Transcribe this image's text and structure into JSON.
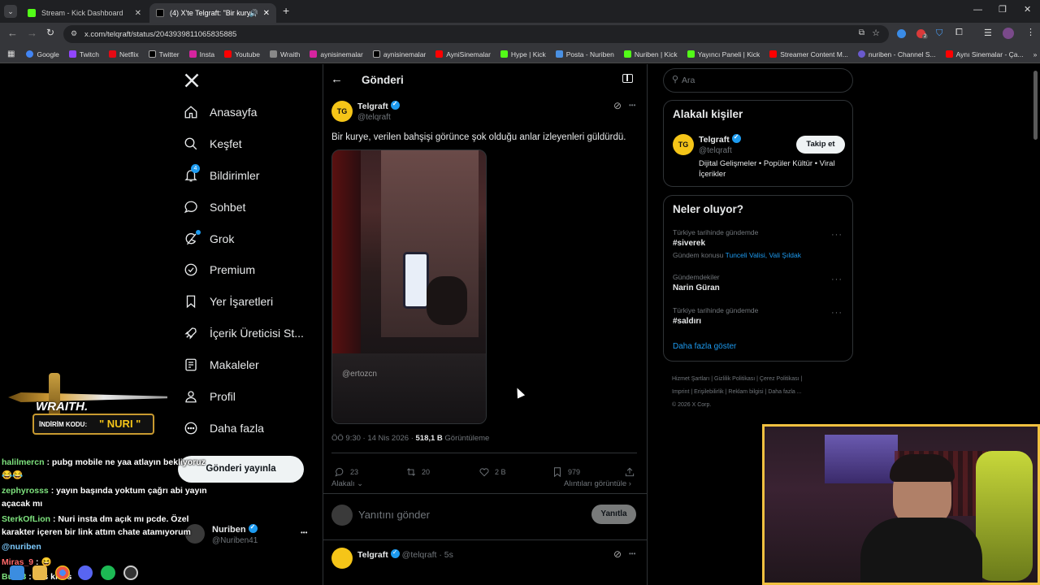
{
  "browser": {
    "tabs": [
      {
        "title": "Stream - Kick Dashboard",
        "active": false
      },
      {
        "title": "(4) X'te Telgraft: \"Bir kurye, ",
        "active": true
      }
    ],
    "new_tab_symbol": "+",
    "url": "x.com/telqraft/status/2043939811065835885",
    "bookmarks": [
      "Google",
      "Twitch",
      "Netflix",
      "Twitter",
      "Insta",
      "Youtube",
      "Wraith",
      "aynisinemalar",
      "aynisinemalar",
      "AyniSinemalar",
      "Hype | Kick",
      "Posta - Nuriben",
      "Nuriben | Kick",
      "Yayıncı Paneli | Kick",
      "Streamer Content M...",
      "nuriben - Channel S...",
      "Aynı Sinemalar - Ça..."
    ],
    "extension_badge": "2"
  },
  "sidebar": {
    "items": [
      {
        "label": "Anasayfa",
        "icon": "home-icon"
      },
      {
        "label": "Keşfet",
        "icon": "search-icon"
      },
      {
        "label": "Bildirimler",
        "icon": "bell-icon"
      },
      {
        "label": "Sohbet",
        "icon": "chat-icon"
      },
      {
        "label": "Grok",
        "icon": "grok-icon"
      },
      {
        "label": "Premium",
        "icon": "premium-icon"
      },
      {
        "label": "Yer İşaretleri",
        "icon": "bookmark-icon"
      },
      {
        "label": "İçerik Üreticisi St...",
        "icon": "rocket-icon"
      },
      {
        "label": "Makaleler",
        "icon": "article-icon"
      },
      {
        "label": "Profil",
        "icon": "person-icon"
      },
      {
        "label": "Daha fazla",
        "icon": "more-circle-icon"
      }
    ],
    "notification_badge": "4",
    "post_button": "Gönderi yayınla",
    "account": {
      "name": "Nuriben",
      "handle": "@Nuriben41",
      "menu": "•••"
    }
  },
  "main": {
    "header_title": "Gönderi",
    "tweet": {
      "author": "Telgraft",
      "handle": "@telqraft",
      "text": "Bir kurye, verilen bahşişi görünce şok olduğu anlar izleyenleri güldürdü.",
      "video_watermark": "@ertozcn",
      "time": "ÖÖ 9:30 · 14 Nis 2026 ·",
      "views_value": "518,1 B",
      "views_label": "Görüntüleme",
      "replies": "23",
      "retweets": "20",
      "likes": "2 B",
      "bookmarks": "979",
      "sort_label": "Alakalı",
      "quotes_link": "Alıntıları görüntüle",
      "reply_placeholder": "Yanıtını gönder",
      "reply_button": "Yanıtla",
      "more": "•••"
    },
    "next_tweet": {
      "author": "Telgraft",
      "handle": "@telqraft",
      "time": "· 5s"
    }
  },
  "right": {
    "search_placeholder": "Ara",
    "related_title": "Alakalı kişiler",
    "related": {
      "name": "Telgraft",
      "handle": "@telqraft",
      "bio": "Dijital Gelişmeler • Popüler Kültür • Viral İçerikler",
      "follow": "Takip et"
    },
    "trends_title": "Neler oluyor?",
    "trends": [
      {
        "context": "Türkiye tarihinde gündemde",
        "name": "#siverek",
        "sub_prefix": "Gündem konusu",
        "sub_link": "Tunceli Valisi, Vali Şıldak"
      },
      {
        "context": "Gündemdekiler",
        "name": "Narin Güran",
        "sub_prefix": "",
        "sub_link": ""
      },
      {
        "context": "Türkiye tarihinde gündemde",
        "name": "#saldırı",
        "sub_prefix": "",
        "sub_link": ""
      }
    ],
    "show_more": "Daha fazla göster",
    "footer_line1": [
      "Hizmet Şartları",
      "Gizlilik Politikası",
      "Çerez Politikası"
    ],
    "footer_line2": [
      "Imprint",
      "Erişilebilirlik",
      "Reklam bilgisi",
      "Daha fazla ..."
    ],
    "footer_line3": "© 2026 X Corp."
  },
  "overlay": {
    "banner_brand": "WRAITH.",
    "banner_code_label": "İNDİRİM KODU:",
    "banner_code": "\" NURI \"",
    "chat": [
      {
        "user": "halilmercn",
        "color": "#7ee37e",
        "message": ": pubg mobile ne yaa atlayın bekliyoruz 😂😂"
      },
      {
        "user": "zephyrosss",
        "color": "#7ee37e",
        "message": ": yayın başında yoktum çağrı abi yayın açacak mı"
      },
      {
        "user": "SterkOfLion",
        "color": "#7ee37e",
        "message": ": Nuri insta dm açık mı pcde. Özel karakter içeren bir link attım chate atamıyorum"
      },
      {
        "user": "@nuriben",
        "color": "#7ecbff",
        "message": ""
      },
      {
        "user": "Miras_9",
        "color": "#ff6a6a",
        "message": ": 😆"
      },
      {
        "user": "Burn3",
        "color": "#7ee37e",
        "message": ": ses kısss"
      }
    ]
  },
  "colors": {
    "accent": "#1d9bf0",
    "border": "#2f3336",
    "muted": "#71767b"
  }
}
